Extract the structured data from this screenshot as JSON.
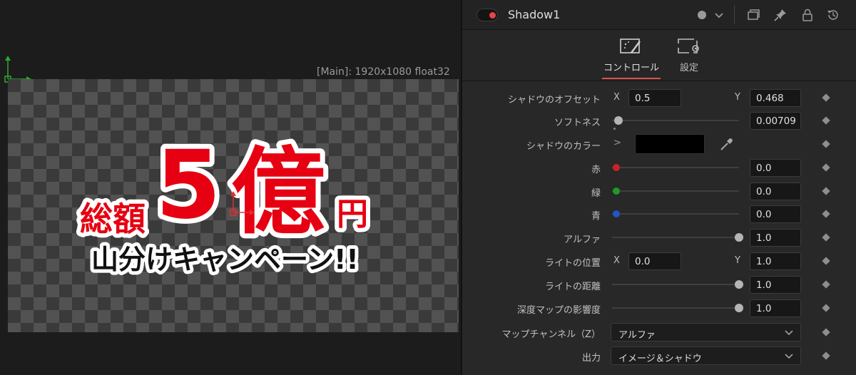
{
  "viewer": {
    "resolution_label": "[Main]: 1920x1080 float32",
    "graphic": {
      "line1_left": "総額",
      "line1_big_number": "5",
      "line1_big_kanji": "億",
      "line1_right": "円",
      "line2": "山分けキャンペーン!!",
      "fill_color": "#e60012",
      "line2_color": "#111111",
      "outline_color": "#ffffff"
    }
  },
  "inspector": {
    "node_name": "Shadow1",
    "header_icons": [
      "chevron-down-icon",
      "window-icon",
      "pin-icon",
      "lock-icon",
      "reset-icon"
    ],
    "tabs": [
      {
        "label": "コントロール",
        "icon": "magic-wand-icon",
        "active": true
      },
      {
        "label": "設定",
        "icon": "gear-icon",
        "active": false
      }
    ],
    "accent_color": "#d9534f",
    "params": {
      "shadow_offset": {
        "label": "シャドウのオフセット",
        "x_label": "X",
        "x_value": "0.5",
        "y_label": "Y",
        "y_value": "0.468"
      },
      "softness": {
        "label": "ソフトネス",
        "value": "0.00709",
        "level": 0.05
      },
      "shadow_color": {
        "label": "シャドウのカラー",
        "expand": ">",
        "color": "#000000"
      },
      "red": {
        "label": "赤",
        "value": "0.0",
        "level": 0.0,
        "color": "#cc2222"
      },
      "green": {
        "label": "緑",
        "value": "0.0",
        "level": 0.0,
        "color": "#1f9a2a"
      },
      "blue": {
        "label": "青",
        "value": "0.0",
        "level": 0.0,
        "color": "#2255c8"
      },
      "alpha": {
        "label": "アルファ",
        "value": "1.0",
        "level": 1.0
      },
      "light_position": {
        "label": "ライトの位置",
        "x_label": "X",
        "x_value": "0.0",
        "y_label": "Y",
        "y_value": "1.0"
      },
      "light_distance": {
        "label": "ライトの距離",
        "value": "1.0",
        "level": 1.0
      },
      "depth_map": {
        "label": "深度マップの影響度",
        "value": "1.0",
        "level": 1.0
      },
      "map_channel": {
        "label": "マップチャンネル（Z）",
        "value": "アルファ"
      },
      "output": {
        "label": "出力",
        "value": "イメージ＆シャドウ"
      }
    }
  }
}
